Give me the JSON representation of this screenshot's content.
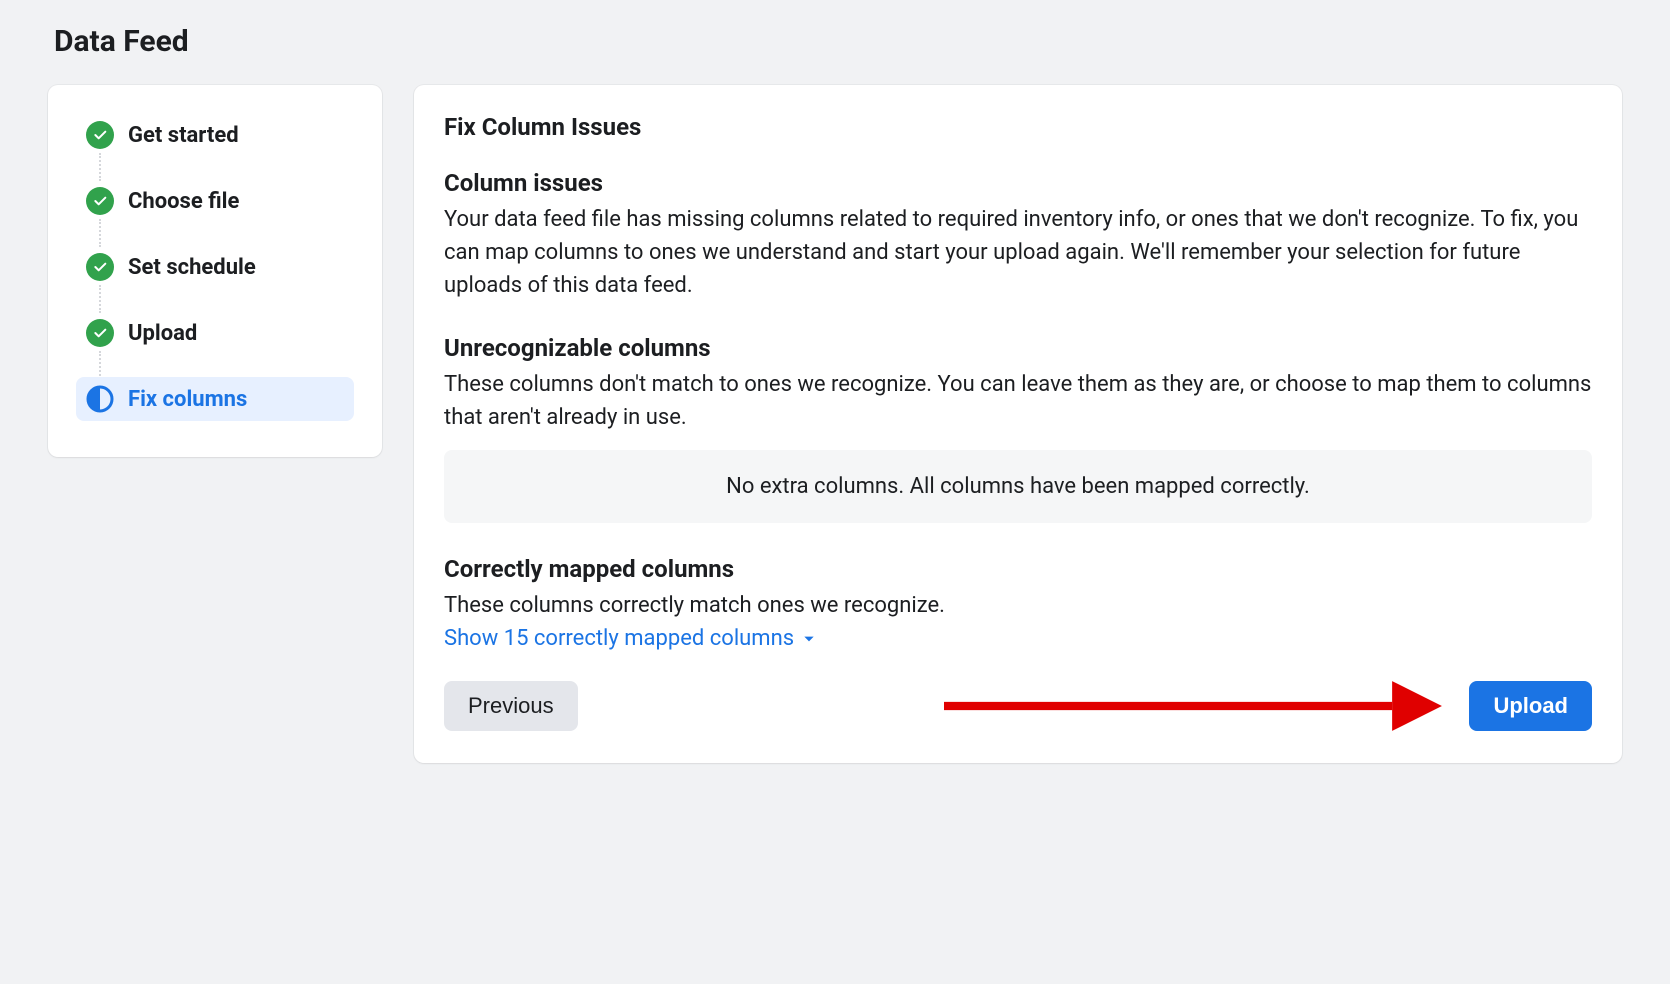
{
  "page": {
    "title": "Data Feed"
  },
  "sidebar": {
    "steps": [
      {
        "label": "Get started",
        "status": "complete"
      },
      {
        "label": "Choose file",
        "status": "complete"
      },
      {
        "label": "Set schedule",
        "status": "complete"
      },
      {
        "label": "Upload",
        "status": "complete"
      },
      {
        "label": "Fix columns",
        "status": "active"
      }
    ]
  },
  "main": {
    "title": "Fix Column Issues",
    "sections": {
      "column_issues": {
        "heading": "Column issues",
        "body": "Your data feed file has missing columns related to required inventory info, or ones that we don't recognize. To fix, you can map columns to ones we understand and start your upload again. We'll remember your selection for future uploads of this data feed."
      },
      "unrecognizable": {
        "heading": "Unrecognizable columns",
        "body": "These columns don't match to ones we recognize. You can leave them as they are, or choose to map them to columns that aren't already in use.",
        "notice": "No extra columns. All columns have been mapped correctly."
      },
      "correctly_mapped": {
        "heading": "Correctly mapped columns",
        "body": "These columns correctly match ones we recognize.",
        "show_link": "Show 15 correctly mapped columns"
      }
    },
    "buttons": {
      "previous": "Previous",
      "upload": "Upload"
    }
  }
}
